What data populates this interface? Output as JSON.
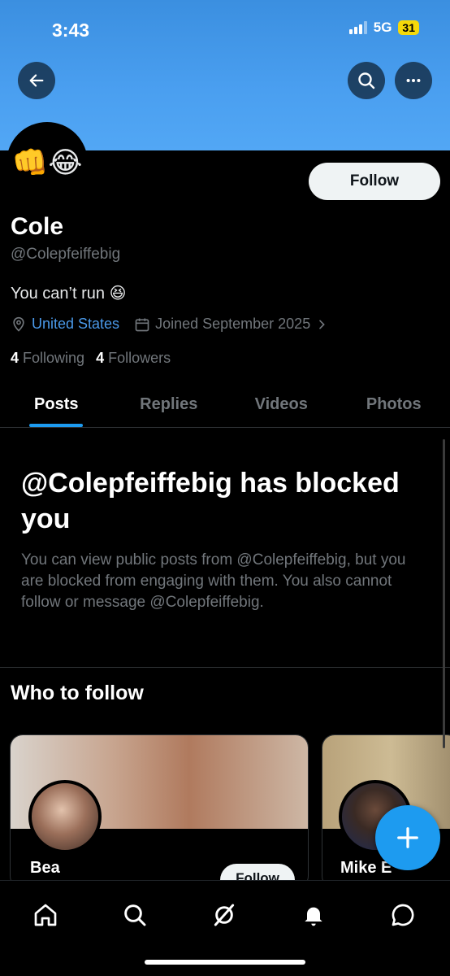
{
  "status_bar": {
    "time": "3:43",
    "network": "5G",
    "battery": "31"
  },
  "header": {
    "back_icon": "arrow-left-icon",
    "search_icon": "search-icon",
    "more_icon": "more-horizontal-icon"
  },
  "profile": {
    "avatar_emoji": "👊😂",
    "follow_label": "Follow",
    "name": "Cole",
    "handle": "@Colepfeiffebig",
    "bio": "You can’t run 😆",
    "location": "United States",
    "joined": "Joined September 2025",
    "following_count": "4",
    "following_label": "Following",
    "followers_count": "4",
    "followers_label": "Followers"
  },
  "tabs": [
    {
      "label": "Posts",
      "active": true
    },
    {
      "label": "Replies",
      "active": false
    },
    {
      "label": "Videos",
      "active": false
    },
    {
      "label": "Photos",
      "active": false
    }
  ],
  "blocked": {
    "title": "@Colepfeiffebig has blocked you",
    "description": "You can view public posts from @Colepfeiffebig, but you are blocked from engaging with them. You also cannot follow or message @Colepfeiffebig."
  },
  "who_to_follow": {
    "title": "Who to follow",
    "cards": [
      {
        "name": "Bea",
        "follow_label": "Follow"
      },
      {
        "name": "Mike E"
      }
    ]
  },
  "colors": {
    "accent": "#1d9bf0",
    "background": "#000000",
    "banner": "#4a9ff0",
    "battery": "#f5d90a"
  },
  "bottom_nav": [
    "home-icon",
    "search-icon",
    "grok-icon",
    "notifications-bell-icon",
    "messages-icon"
  ]
}
